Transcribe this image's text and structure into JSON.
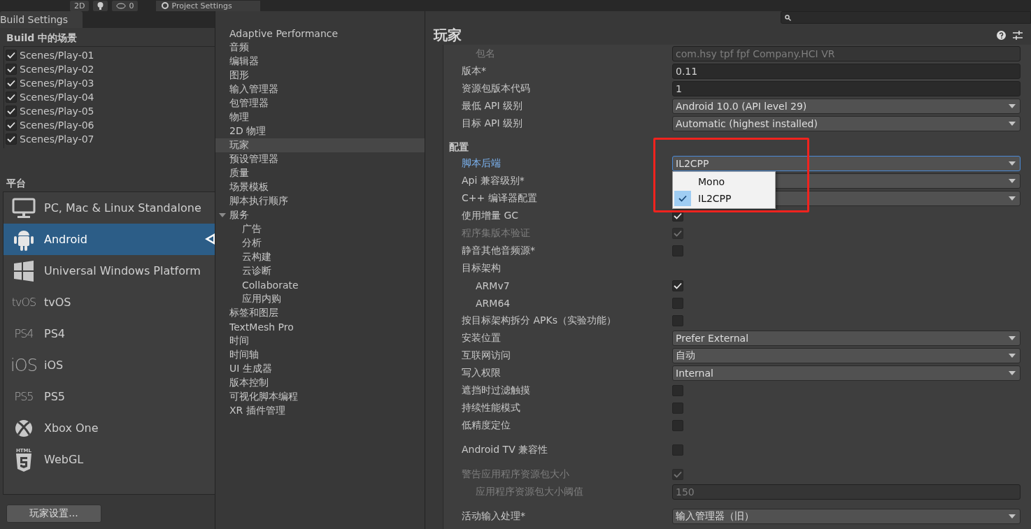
{
  "toolbar": {
    "items": [
      "2D",
      "0"
    ],
    "tab": "Project Settings"
  },
  "build": {
    "tab": "Build Settings",
    "scenes_title": "Build 中的场景",
    "scenes": [
      {
        "label": "Scenes/Play-01",
        "checked": true
      },
      {
        "label": "Scenes/Play-02",
        "checked": true
      },
      {
        "label": "Scenes/Play-03",
        "checked": true
      },
      {
        "label": "Scenes/Play-04",
        "checked": true
      },
      {
        "label": "Scenes/Play-05",
        "checked": true
      },
      {
        "label": "Scenes/Play-06",
        "checked": true
      },
      {
        "label": "Scenes/Play-07",
        "checked": true
      }
    ],
    "platforms_title": "平台",
    "platforms": [
      {
        "kind": "desktop",
        "label": "PC, Mac & Linux Standalone",
        "selected": false,
        "current": false
      },
      {
        "kind": "android",
        "label": "Android",
        "selected": true,
        "current": true
      },
      {
        "kind": "windows",
        "label": "Universal Windows Platform",
        "selected": false,
        "current": false
      },
      {
        "kind": "logo",
        "logo": "tvOS",
        "label": "tvOS",
        "selected": false,
        "current": false
      },
      {
        "kind": "logo",
        "logo": "PS4",
        "label": "PS4",
        "selected": false,
        "current": false
      },
      {
        "kind": "logo",
        "logo": "iOS",
        "label": "iOS",
        "selected": false,
        "current": false
      },
      {
        "kind": "logo",
        "logo": "PS5",
        "label": "PS5",
        "selected": false,
        "current": false
      },
      {
        "kind": "xbox",
        "label": "Xbox One",
        "selected": false,
        "current": false
      },
      {
        "kind": "html5",
        "logo": "HTML",
        "label": "WebGL",
        "selected": false,
        "current": false
      }
    ],
    "button": "玩家设置..."
  },
  "nav": [
    {
      "label": "Adaptive Performance",
      "selected": false
    },
    {
      "label": "音频",
      "selected": false
    },
    {
      "label": "编辑器",
      "selected": false
    },
    {
      "label": "图形",
      "selected": false
    },
    {
      "label": "输入管理器",
      "selected": false
    },
    {
      "label": "包管理器",
      "selected": false
    },
    {
      "label": "物理",
      "selected": false
    },
    {
      "label": "2D 物理",
      "selected": false
    },
    {
      "label": "玩家",
      "selected": true
    },
    {
      "label": "预设管理器",
      "selected": false
    },
    {
      "label": "质量",
      "selected": false
    },
    {
      "label": "场景模板",
      "selected": false
    },
    {
      "label": "脚本执行顺序",
      "selected": false
    },
    {
      "label": "服务",
      "selected": false,
      "expanded": true,
      "children": [
        {
          "label": "广告",
          "selected": false
        },
        {
          "label": "分析",
          "selected": false
        },
        {
          "label": "云构建",
          "selected": false
        },
        {
          "label": "云诊断",
          "selected": false
        },
        {
          "label": "Collaborate",
          "selected": false
        },
        {
          "label": "应用内购",
          "selected": false
        }
      ]
    },
    {
      "label": "标签和图层",
      "selected": false
    },
    {
      "label": "TextMesh Pro",
      "selected": false
    },
    {
      "label": "时间",
      "selected": false
    },
    {
      "label": "时间轴",
      "selected": false
    },
    {
      "label": "UI 生成器",
      "selected": false
    },
    {
      "label": "版本控制",
      "selected": false
    },
    {
      "label": "可视化脚本编程",
      "selected": false
    },
    {
      "label": "XR 插件管理",
      "selected": false
    }
  ],
  "settings": {
    "title": "玩家",
    "groups": [
      {
        "rows": [
          {
            "kind": "field",
            "label": "包名",
            "value": "com.hsy tpf fpf Company.HCI VR",
            "indent": true,
            "disabled": true
          },
          {
            "kind": "field",
            "label": "版本*",
            "value": "0.11"
          },
          {
            "kind": "field",
            "label": "资源包版本代码",
            "value": "1"
          },
          {
            "kind": "dropdown",
            "label": "最低 API 级别",
            "value": "Android 10.0 (API level 29)"
          },
          {
            "kind": "dropdown",
            "label": "目标 API 级别",
            "value": "Automatic (highest installed)"
          }
        ]
      },
      {
        "title": "配置",
        "rows": [
          {
            "kind": "dropdown",
            "label": "脚本后端",
            "value": "IL2CPP",
            "focused": true,
            "options": [
              {
                "label": "Mono",
                "selected": false
              },
              {
                "label": "IL2CPP",
                "selected": true
              }
            ]
          },
          {
            "kind": "dropdown",
            "label": "Api 兼容级别*"
          },
          {
            "kind": "dropdown",
            "label": "C++ 编译器配置"
          },
          {
            "kind": "checkbox",
            "label": "使用增量 GC",
            "checked": true
          },
          {
            "kind": "checkbox",
            "label": "程序集版本验证",
            "checked": true,
            "disabled": true
          },
          {
            "kind": "checkbox",
            "label": "静音其他音频源*",
            "checked": false
          },
          {
            "kind": "label",
            "label": "目标架构"
          },
          {
            "kind": "checkbox",
            "label": "ARMv7",
            "checked": true,
            "indent": true
          },
          {
            "kind": "checkbox",
            "label": "ARM64",
            "checked": false,
            "indent": true
          },
          {
            "kind": "checkbox",
            "label": "按目标架构拆分 APKs（实验功能）",
            "checked": false
          },
          {
            "kind": "dropdown",
            "label": "安装位置",
            "value": "Prefer External"
          },
          {
            "kind": "dropdown",
            "label": "互联网访问",
            "value": "自动"
          },
          {
            "kind": "dropdown",
            "label": "写入权限",
            "value": "Internal"
          },
          {
            "kind": "checkbox",
            "label": "遮挡时过滤触摸",
            "checked": false
          },
          {
            "kind": "checkbox",
            "label": "持续性能模式",
            "checked": false
          },
          {
            "kind": "checkbox",
            "label": "低精度定位",
            "checked": false
          }
        ]
      },
      {
        "rows": [
          {
            "kind": "checkbox",
            "label": "Android TV 兼容性",
            "checked": false
          }
        ]
      },
      {
        "rows": [
          {
            "kind": "checkbox",
            "label": "警告应用程序资源包大小",
            "checked": true,
            "disabled": true
          },
          {
            "kind": "field",
            "label": "应用程序资源包大小阈值",
            "value": "150",
            "indent": true,
            "disabled": true
          }
        ]
      },
      {
        "rows": [
          {
            "kind": "dropdown",
            "label": "活动输入处理*",
            "value": "输入管理器（旧）"
          }
        ]
      }
    ]
  }
}
